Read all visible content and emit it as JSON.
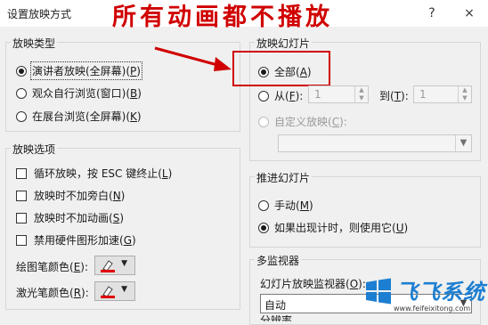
{
  "dialog": {
    "title": "设置放映方式",
    "help_glyph": "?",
    "close_glyph": "×"
  },
  "annotation": {
    "text": "所有动画都不播放",
    "color": "#d00000"
  },
  "show_type": {
    "label": "放映类型",
    "options": [
      {
        "text": "演讲者放映(全屏幕)(",
        "key": "P",
        "suffix": ")",
        "checked": true
      },
      {
        "text": "观众自行浏览(窗口)(",
        "key": "B",
        "suffix": ")",
        "checked": false
      },
      {
        "text": "在展台浏览(全屏幕)(",
        "key": "K",
        "suffix": ")",
        "checked": false
      }
    ]
  },
  "show_options": {
    "label": "放映选项",
    "items": [
      {
        "text": "循环放映，按 ESC 键终止(",
        "key": "L",
        "suffix": ")",
        "checked": false
      },
      {
        "text": "放映时不加旁白(",
        "key": "N",
        "suffix": ")",
        "checked": false
      },
      {
        "text": "放映时不加动画(",
        "key": "S",
        "suffix": ")",
        "checked": false
      },
      {
        "text": "禁用硬件图形加速(",
        "key": "G",
        "suffix": ")",
        "checked": false
      }
    ],
    "pen_color_label": "绘图笔颜色(",
    "pen_color_key": "E",
    "pen_color_suffix": "):",
    "laser_color_label": "激光笔颜色(",
    "laser_color_key": "R",
    "laser_color_suffix": "):",
    "pen_color": "#e00000",
    "laser_color": "#e00000"
  },
  "show_slides": {
    "label": "放映幻灯片",
    "all_text": "全部(",
    "all_key": "A",
    "all_suffix": ")",
    "all_checked": true,
    "from_text": "从(",
    "from_key": "F",
    "from_suffix": "):",
    "from_value": "1",
    "to_text": "到(",
    "to_key": "T",
    "to_suffix": "):",
    "to_value": "1",
    "custom_text": "自定义放映(",
    "custom_key": "C",
    "custom_suffix": "):"
  },
  "advance_slides": {
    "label": "推进幻灯片",
    "manual_text": "手动(",
    "manual_key": "M",
    "manual_suffix": ")",
    "manual_checked": false,
    "timing_text": "如果出现计时，则使用它(",
    "timing_key": "U",
    "timing_suffix": ")",
    "timing_checked": true
  },
  "monitors": {
    "label": "多监视器",
    "monitor_label": "幻灯片放映监视器(",
    "monitor_key": "O",
    "monitor_suffix": "):",
    "monitor_value": "自动",
    "resolution_label_partial": "分辨率"
  },
  "watermark": {
    "name": "飞飞系统",
    "url": "www.feifeixitong.com",
    "brand_color": "#1d7fd1"
  }
}
